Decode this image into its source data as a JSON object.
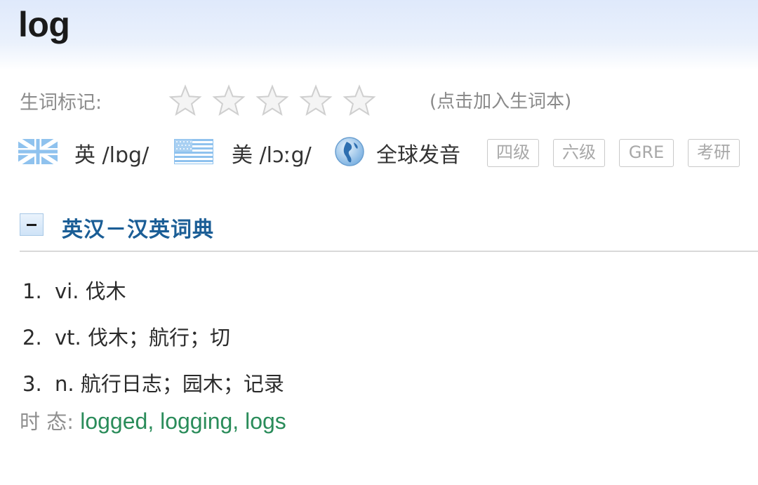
{
  "word": "log",
  "mark": {
    "label": "生词标记:",
    "stars_filled": 0,
    "stars_total": 5,
    "hint": "(点击加入生词本)"
  },
  "pronunciation": {
    "uk": {
      "text": "英 /lɒg/",
      "icon": "uk-flag-icon"
    },
    "us": {
      "text": "美 /lɔːg/",
      "icon": "us-flag-icon"
    },
    "global": {
      "text": "全球发音",
      "icon": "globe-icon"
    }
  },
  "tags": [
    "四级",
    "六级",
    "GRE",
    "考研"
  ],
  "dictionary": {
    "title": "英汉－汉英词典",
    "definitions": [
      {
        "num": "1.",
        "text": "vi. 伐木"
      },
      {
        "num": "2.",
        "text": "vt. 伐木；航行；切"
      },
      {
        "num": "3.",
        "text": "n. 航行日志；园木；记录"
      }
    ],
    "tense_label": "时 态: ",
    "tense_forms": "logged, logging, logs"
  },
  "colors": {
    "title_blue": "#1b5e96",
    "tense_green": "#2a8c5a",
    "label_gray": "#8c8c8c"
  }
}
